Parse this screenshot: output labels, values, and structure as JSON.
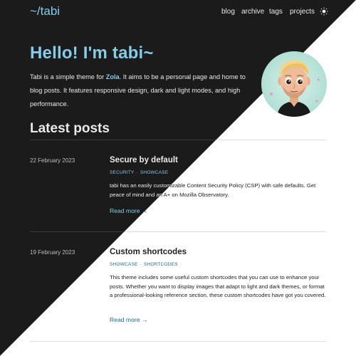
{
  "site": {
    "logo": "~/tabi"
  },
  "nav": {
    "items": [
      {
        "label": "blog"
      },
      {
        "label": "archive"
      },
      {
        "label": "tags"
      },
      {
        "label": "projects"
      }
    ],
    "theme_toggle_icon": "sun-icon"
  },
  "hero": {
    "title": "Hello! I'm tabi~",
    "desc_pre": "Tabi is a simple theme for ",
    "desc_link": "Zola",
    "desc_post": ". It aims to be a personal page and home to blog posts. It features responsive design, dark and light modes, and high performance.",
    "avatar_icon": "avatar-illustration"
  },
  "latest": {
    "title": "Latest posts",
    "posts": [
      {
        "date": "22 February 2023",
        "title": "Secure by default",
        "tags": [
          "SECURITY",
          "SHOWCASE"
        ],
        "excerpt": "tabi has an easily customizable Content Security Policy (CSP) with safe defaults. Get peace of mind and an A+ on Mozilla Observatory.",
        "read_more": "Read more →"
      },
      {
        "date": "19 February 2023",
        "title": "Custom shortcodes",
        "tags": [
          "SHOWCASE",
          "SHORTCODES"
        ],
        "excerpt": "This theme includes some useful custom shortcodes that you can use to enhance your posts. Whether you want to display images that adapt to light and dark themes, or format a professional-looking reference section, these custom shortcodes have got you covered.",
        "read_more": "Read more →"
      }
    ]
  },
  "colors": {
    "dark_bg": "#1b1b1b",
    "light_bg": "#ffffff",
    "dark_accent": "#86cbe8",
    "light_accent": "#1c6a8f"
  }
}
